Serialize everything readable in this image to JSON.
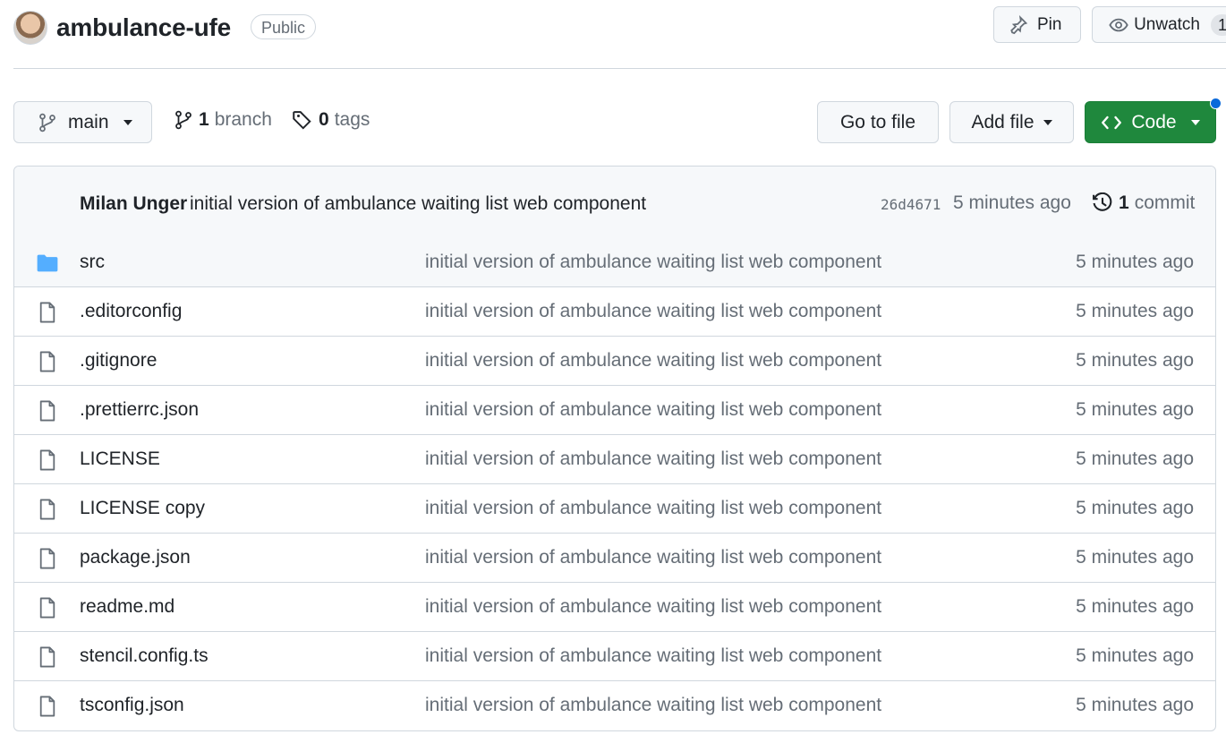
{
  "repo": {
    "name": "ambulance-ufe",
    "visibility": "Public"
  },
  "actions": {
    "pin_label": "Pin",
    "watch_label": "Unwatch",
    "watch_count": "1"
  },
  "branch_bar": {
    "current_branch": "main",
    "branch_count": "1",
    "branch_label": "branch",
    "tag_count": "0",
    "tag_label": "tags",
    "go_to_file_label": "Go to file",
    "add_file_label": "Add file",
    "code_label": "Code"
  },
  "latest_commit": {
    "author": "Milan Unger",
    "message": "initial version of ambulance waiting list web component",
    "sha": "26d4671",
    "time": "5 minutes ago",
    "commit_count": "1",
    "commit_label": "commit"
  },
  "files": [
    {
      "name": "src",
      "type": "folder",
      "message": "initial version of ambulance waiting list web component",
      "time": "5 minutes ago"
    },
    {
      "name": ".editorconfig",
      "type": "file",
      "message": "initial version of ambulance waiting list web component",
      "time": "5 minutes ago"
    },
    {
      "name": ".gitignore",
      "type": "file",
      "message": "initial version of ambulance waiting list web component",
      "time": "5 minutes ago"
    },
    {
      "name": ".prettierrc.json",
      "type": "file",
      "message": "initial version of ambulance waiting list web component",
      "time": "5 minutes ago"
    },
    {
      "name": "LICENSE",
      "type": "file",
      "message": "initial version of ambulance waiting list web component",
      "time": "5 minutes ago"
    },
    {
      "name": "LICENSE copy",
      "type": "file",
      "message": "initial version of ambulance waiting list web component",
      "time": "5 minutes ago"
    },
    {
      "name": "package.json",
      "type": "file",
      "message": "initial version of ambulance waiting list web component",
      "time": "5 minutes ago"
    },
    {
      "name": "readme.md",
      "type": "file",
      "message": "initial version of ambulance waiting list web component",
      "time": "5 minutes ago"
    },
    {
      "name": "stencil.config.ts",
      "type": "file",
      "message": "initial version of ambulance waiting list web component",
      "time": "5 minutes ago"
    },
    {
      "name": "tsconfig.json",
      "type": "file",
      "message": "initial version of ambulance waiting list web component",
      "time": "5 minutes ago"
    }
  ],
  "colors": {
    "accent_green": "#1f883d",
    "folder_blue": "#54aeff",
    "notification_blue": "#0969da",
    "muted_text": "#656d76"
  }
}
